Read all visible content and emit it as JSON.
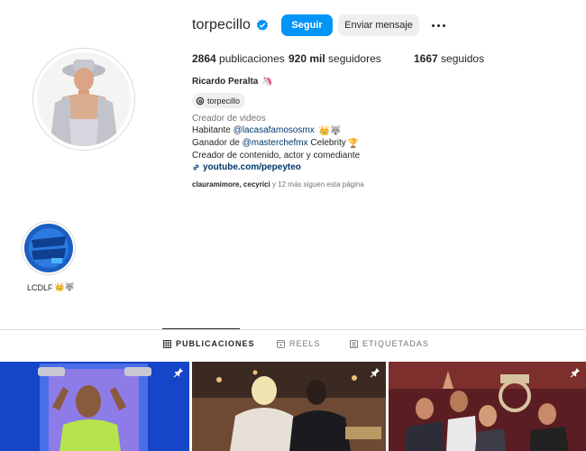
{
  "profile": {
    "username": "torpecillo",
    "full_name": "Ricardo Peralta",
    "name_emoji": "🦄",
    "threads_handle": "torpecillo",
    "verified": true
  },
  "actions": {
    "follow_label": "Seguir",
    "message_label": "Enviar mensaje"
  },
  "stats": {
    "posts_count": "2864",
    "posts_label": "publicaciones",
    "followers_count": "920 mil",
    "followers_label": "seguidores",
    "following_count": "1667",
    "following_label": "seguidos"
  },
  "bio": {
    "category": "Creador de videos",
    "line1_prefix": "Habitante ",
    "line1_mention": "@lacasafamososmx",
    "line1_emoji": "👑🐺",
    "line2_prefix": "Ganador de ",
    "line2_mention": "@masterchefmx",
    "line2_suffix": " Celebrity",
    "line2_emoji": "🏆",
    "line3": "Creador de contenido, actor y comediante",
    "link": "youtube.com/pepeyteo"
  },
  "followed_by": {
    "names": "clauramimore, cecyrici",
    "suffix": " y 12 más siguen esta página"
  },
  "highlights": [
    {
      "label": "LCDLF",
      "emoji": "👑🐺",
      "cover_text": "La casa de los Famosos"
    }
  ],
  "tabs": [
    {
      "label": "PUBLICACIONES",
      "active": true,
      "icon": "grid-icon"
    },
    {
      "label": "REELS",
      "active": false,
      "icon": "reels-icon"
    },
    {
      "label": "ETIQUETADAS",
      "active": false,
      "icon": "tagged-icon"
    }
  ],
  "posts": [
    {
      "pinned": true
    },
    {
      "pinned": true
    },
    {
      "pinned": true
    }
  ],
  "colors": {
    "accent": "#0095f6",
    "link": "#00376b",
    "secondary_text": "#737373",
    "border": "#dbdbdb"
  }
}
